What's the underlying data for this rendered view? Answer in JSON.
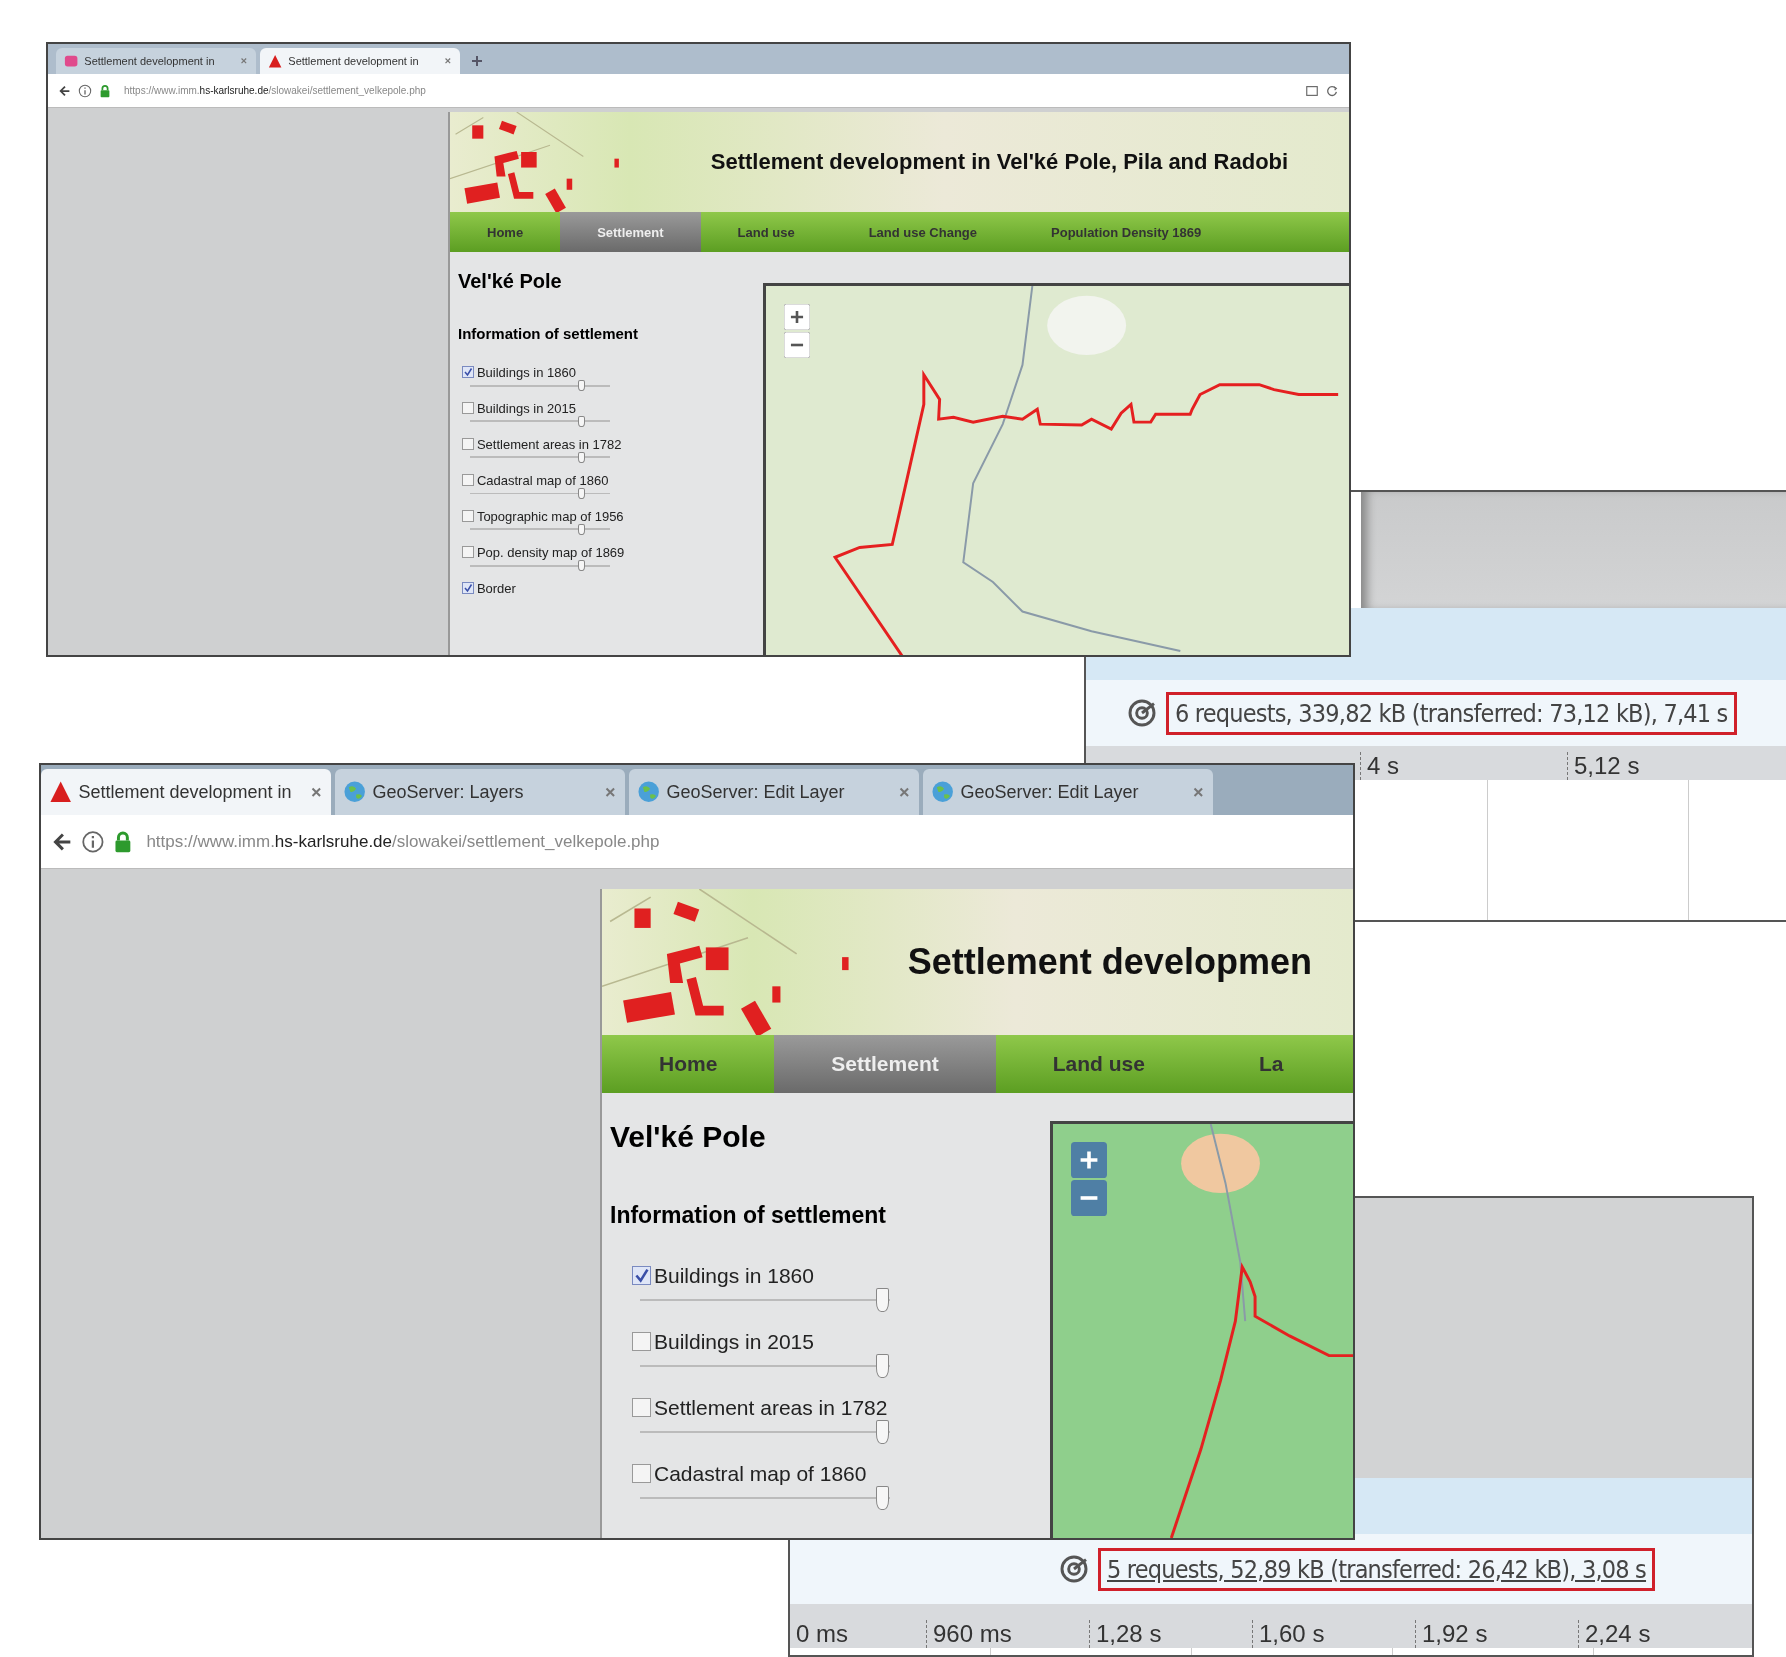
{
  "network_panels": [
    {
      "summary": "6 requests, 339,82 kB (transferred: 73,12 kB), 7,41 s",
      "underlined": false,
      "ticks": [
        "4 s",
        "5,12 s"
      ]
    },
    {
      "summary": "5 requests, 52,89 kB (transferred: 26,42 kB), 3,08 s",
      "underlined": true,
      "ticks": [
        "0 ms",
        "960 ms",
        "1,28 s",
        "1,60 s",
        "1,92 s",
        "2,24 s"
      ]
    }
  ],
  "windows": [
    {
      "tabs": [
        {
          "label": "Settlement development in",
          "kind": "badge",
          "selected": false
        },
        {
          "label": "Settlement development in",
          "kind": "triangle",
          "selected": true
        }
      ],
      "url": "https://www.imm.**hs-karlsruhe.de**/slowakei/settlement_velkepole.php",
      "page": {
        "title": "Settlement development in Vel'ké Pole, Pila and Radobi",
        "nav": [
          {
            "label": "Home",
            "selected": false
          },
          {
            "label": "Settlement",
            "selected": true
          },
          {
            "label": "Land use",
            "selected": false
          },
          {
            "label": "Land use Change",
            "selected": false
          },
          {
            "label": "Population Density 1869",
            "selected": false
          }
        ],
        "heading": "Vel'ké Pole",
        "section": "Information of settlement",
        "layers": [
          {
            "label": "Buildings in 1860",
            "checked": true,
            "level": 0.8
          },
          {
            "label": "Buildings in 2015",
            "checked": false,
            "level": 0.8
          },
          {
            "label": "Settlement areas in 1782",
            "checked": false,
            "level": 0.8
          },
          {
            "label": "Cadastral map of 1860",
            "checked": false,
            "level": 0.8
          },
          {
            "label": "Topographic map of 1956",
            "checked": false,
            "level": 0.8
          },
          {
            "label": "Pop. density map of 1869",
            "checked": false,
            "level": 0.8
          },
          {
            "label": "Border",
            "checked": true
          }
        ]
      }
    },
    {
      "tabs": [
        {
          "label": "Settlement development in",
          "kind": "triangle",
          "selected": true
        },
        {
          "label": "GeoServer: Layers",
          "kind": "globe",
          "selected": false
        },
        {
          "label": "GeoServer: Edit Layer",
          "kind": "globe",
          "selected": false
        },
        {
          "label": "GeoServer: Edit Layer",
          "kind": "globe",
          "selected": false
        }
      ],
      "url": "https://www.imm.**hs-karlsruhe.de**/slowakei/settlement_velkepole.php",
      "page": {
        "title": "Settlement developmen",
        "nav": [
          {
            "label": "Home",
            "selected": false
          },
          {
            "label": "Settlement",
            "selected": true
          },
          {
            "label": "Land use",
            "selected": false
          },
          {
            "label": "La",
            "selected": false
          }
        ],
        "heading": "Vel'ké Pole",
        "section": "Information of settlement",
        "layers": [
          {
            "label": "Buildings in 1860",
            "checked": true,
            "level": 0.97
          },
          {
            "label": "Buildings in 2015",
            "checked": false,
            "level": 0.97
          },
          {
            "label": "Settlement areas in 1782",
            "checked": false,
            "level": 0.97
          },
          {
            "label": "Cadastral map of 1860",
            "checked": false,
            "level": 0.97
          }
        ]
      }
    }
  ]
}
